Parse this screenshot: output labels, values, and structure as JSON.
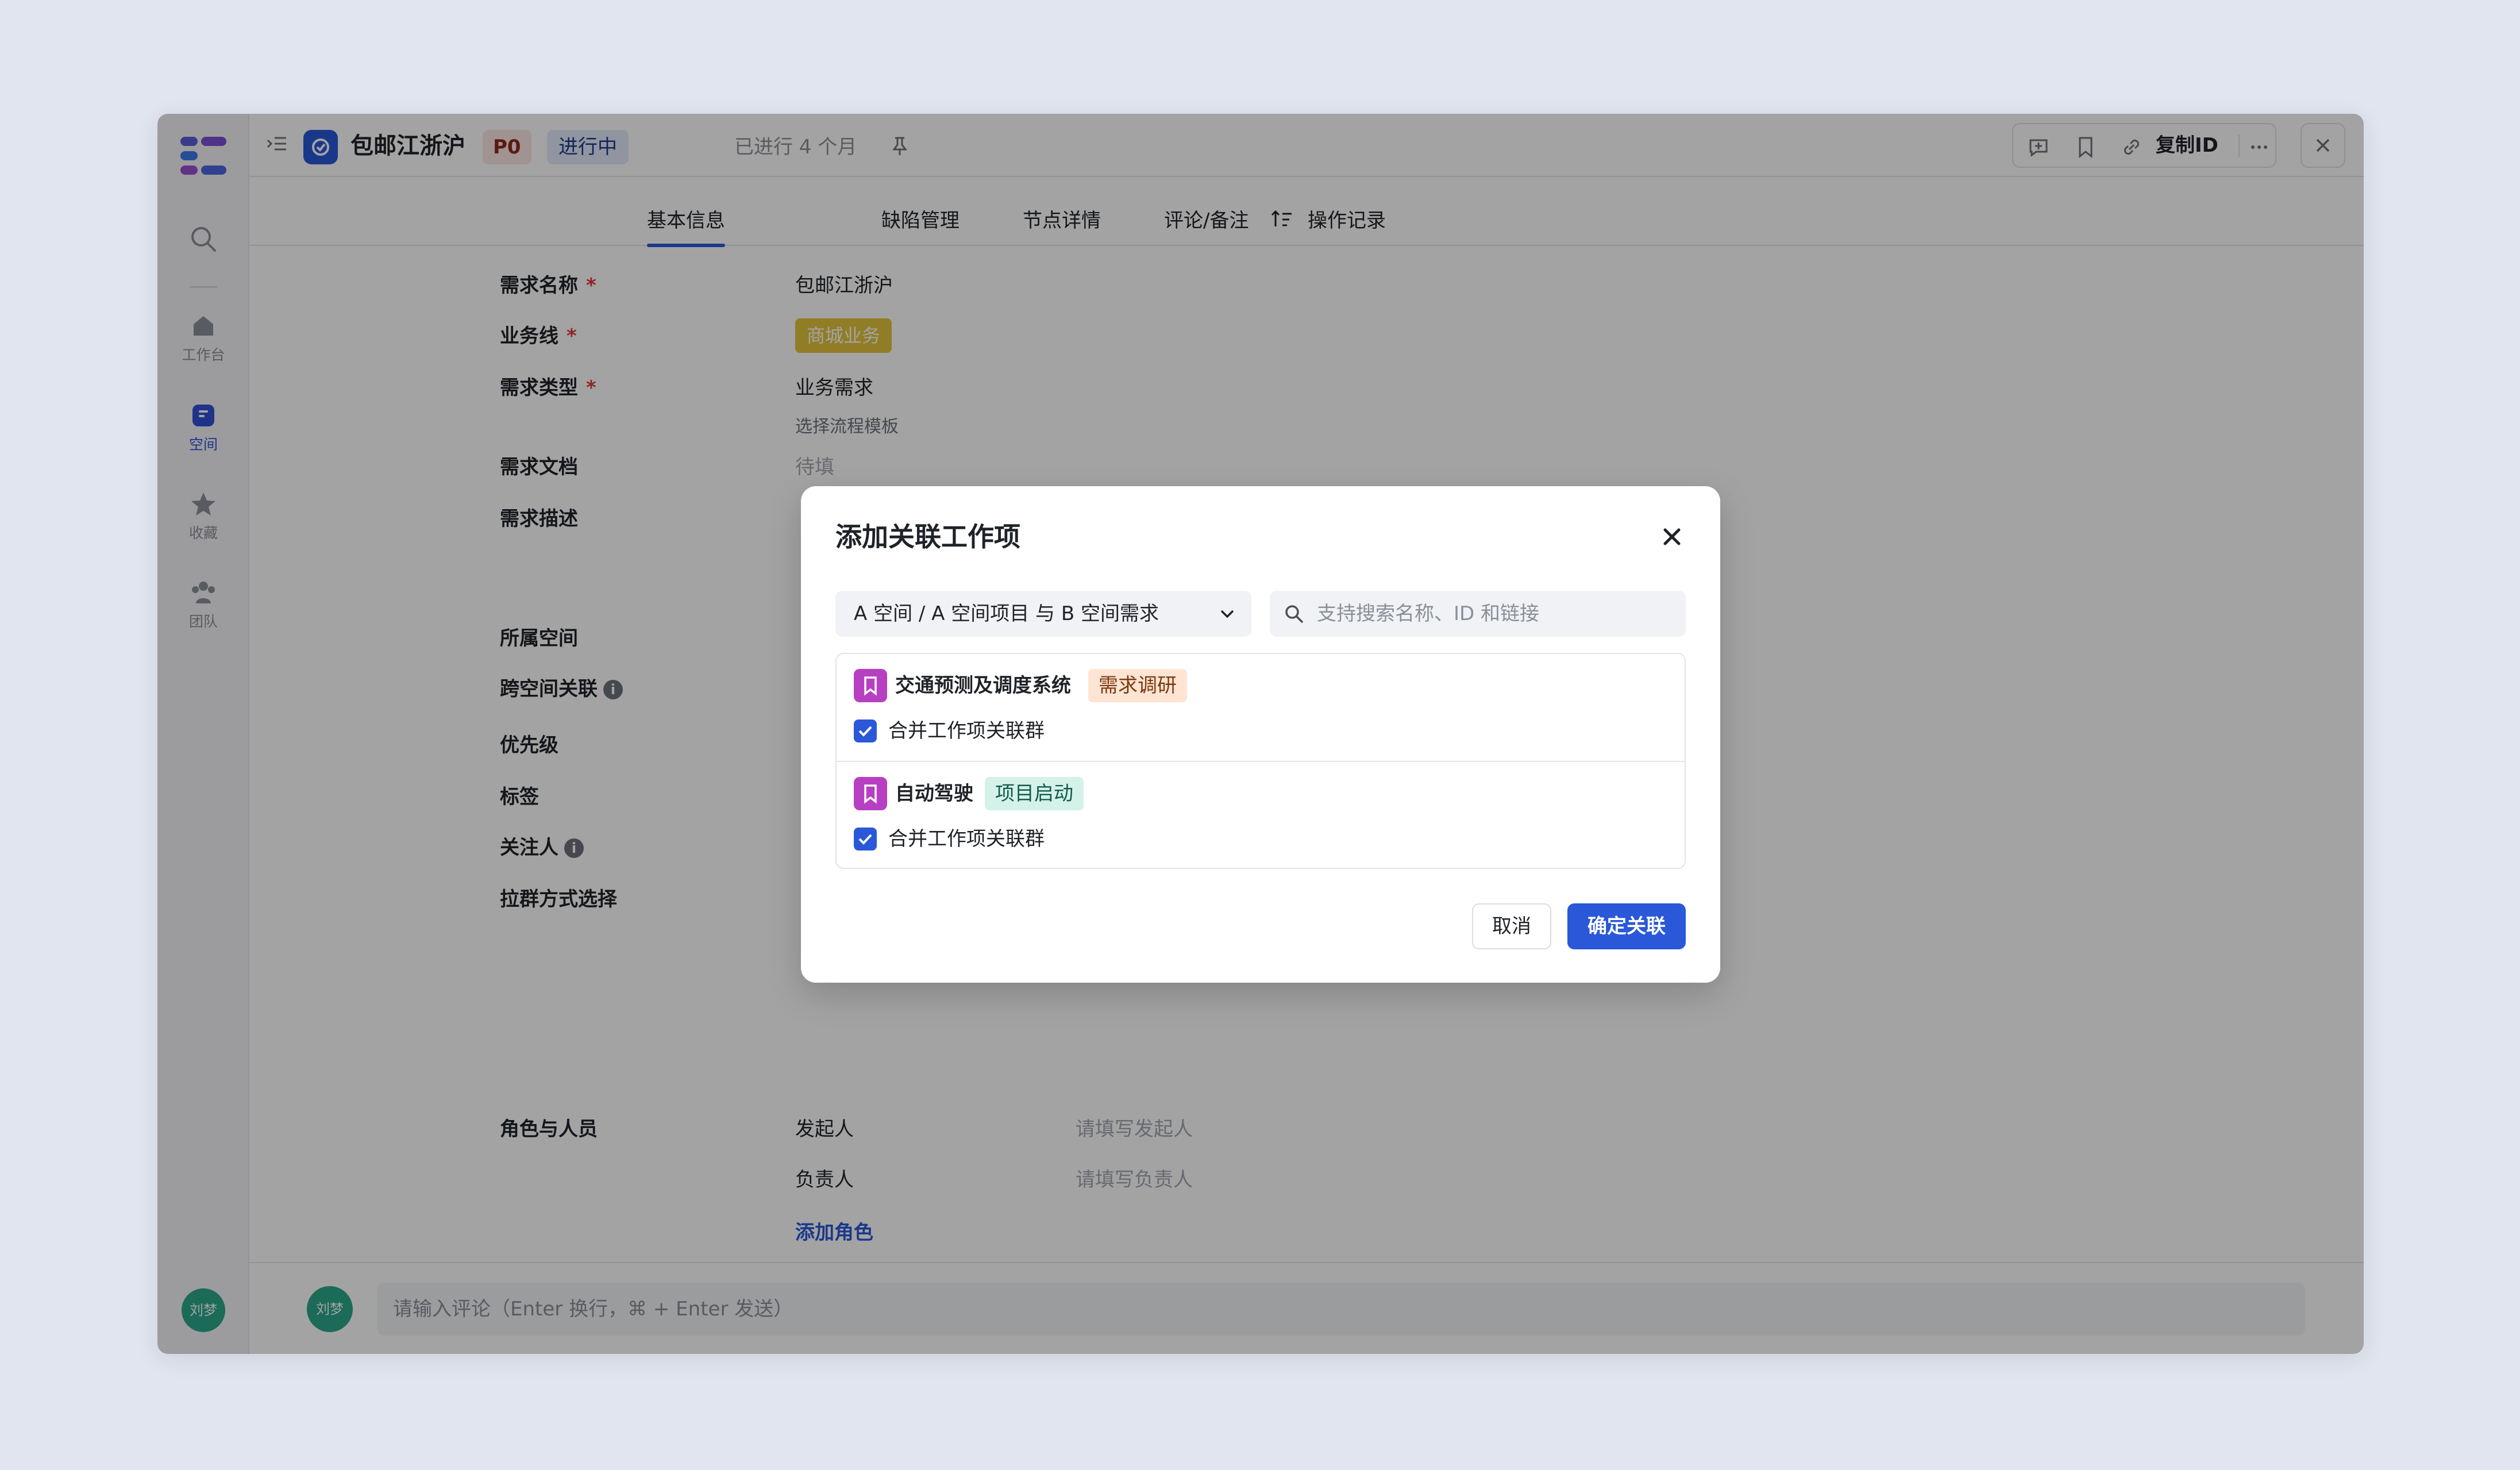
{
  "app": {
    "rail": {
      "items": [
        {
          "label": "工作台",
          "icon": "home-icon"
        },
        {
          "label": "空间",
          "icon": "space-icon",
          "active": true
        },
        {
          "label": "收藏",
          "icon": "star-icon"
        },
        {
          "label": "团队",
          "icon": "team-icon"
        }
      ],
      "avatar": "刘梦"
    },
    "header": {
      "title": "包邮江浙沪",
      "priority": "P0",
      "status": "进行中",
      "elapsed": "已进行 4 个月",
      "copy_id": "复制ID"
    },
    "tabs": [
      {
        "label": "基本信息",
        "active": true
      },
      {
        "label": "缺陷管理"
      },
      {
        "label": "节点详情"
      },
      {
        "label": "评论/备注"
      },
      {
        "label": "操作记录"
      }
    ],
    "form": {
      "name_label": "需求名称",
      "name_value": "包邮江浙沪",
      "business_label": "业务线",
      "business_value": "商城业务",
      "type_label": "需求类型",
      "type_value": "业务需求",
      "template_link": "选择流程模板",
      "doc_label": "需求文档",
      "doc_value": "待填",
      "desc_label": "需求描述",
      "space_label": "所属空间",
      "cross_label": "跨空间关联",
      "priority_label": "优先级",
      "tag_label": "标签",
      "follower_label": "关注人",
      "group_label": "拉群方式选择",
      "roles_label": "角色与人员",
      "roles": [
        {
          "role": "发起人",
          "placeholder": "请填写发起人"
        },
        {
          "role": "负责人",
          "placeholder": "请填写负责人"
        }
      ],
      "add_role": "添加角色",
      "required_mark": "*"
    },
    "comment": {
      "avatar": "刘梦",
      "placeholder": "请输入评论（Enter 换行，⌘ + Enter 发送）"
    }
  },
  "dialog": {
    "title": "添加关联工作项",
    "scope": "A 空间 / A 空间项目 与 B 空间需求",
    "search_placeholder": "支持搜索名称、ID 和链接",
    "items": [
      {
        "name": "交通预测及调度系统",
        "tag": "需求调研",
        "tag_bg": "#fde4d3",
        "tag_color": "#7a3a10",
        "checkbox_label": "合并工作项关联群",
        "checked": true
      },
      {
        "name": "自动驾驶",
        "tag": "项目启动",
        "tag_bg": "#d5f2ea",
        "tag_color": "#135a48",
        "checkbox_label": "合并工作项关联群",
        "checked": true
      }
    ],
    "cancel": "取消",
    "confirm": "确定关联"
  },
  "colors": {
    "primary": "#2a58d8",
    "required": "#e23b3b",
    "business_tag": "#e3c43a",
    "item_icon": "#b73fc2"
  }
}
